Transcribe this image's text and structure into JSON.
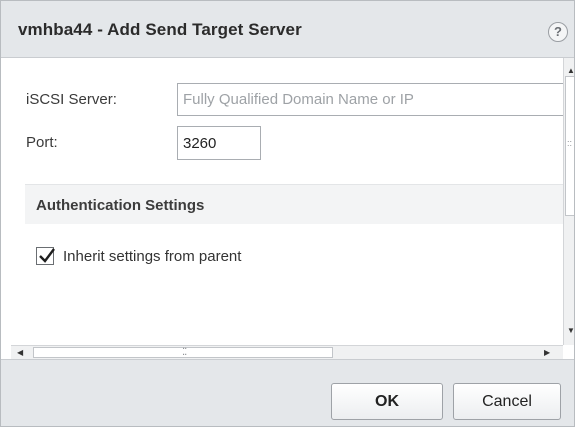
{
  "dialog": {
    "title": "vmhba44 - Add Send Target Server",
    "help_label": "?"
  },
  "form": {
    "server_label": "iSCSI Server:",
    "server_value": "",
    "server_placeholder": "Fully Qualified Domain Name or IP",
    "port_label": "Port:",
    "port_value": "3260"
  },
  "auth": {
    "section_title": "Authentication Settings",
    "inherit_label": "Inherit settings from parent",
    "inherit_checked": true
  },
  "footer": {
    "ok_label": "OK",
    "cancel_label": "Cancel"
  },
  "icons": {
    "help": "help-icon",
    "checkmark": "checkmark-icon",
    "scroll_up": "scroll-up-arrow-icon",
    "scroll_down": "scroll-down-arrow-icon",
    "scroll_left": "scroll-left-arrow-icon",
    "scroll_right": "scroll-right-arrow-icon"
  }
}
